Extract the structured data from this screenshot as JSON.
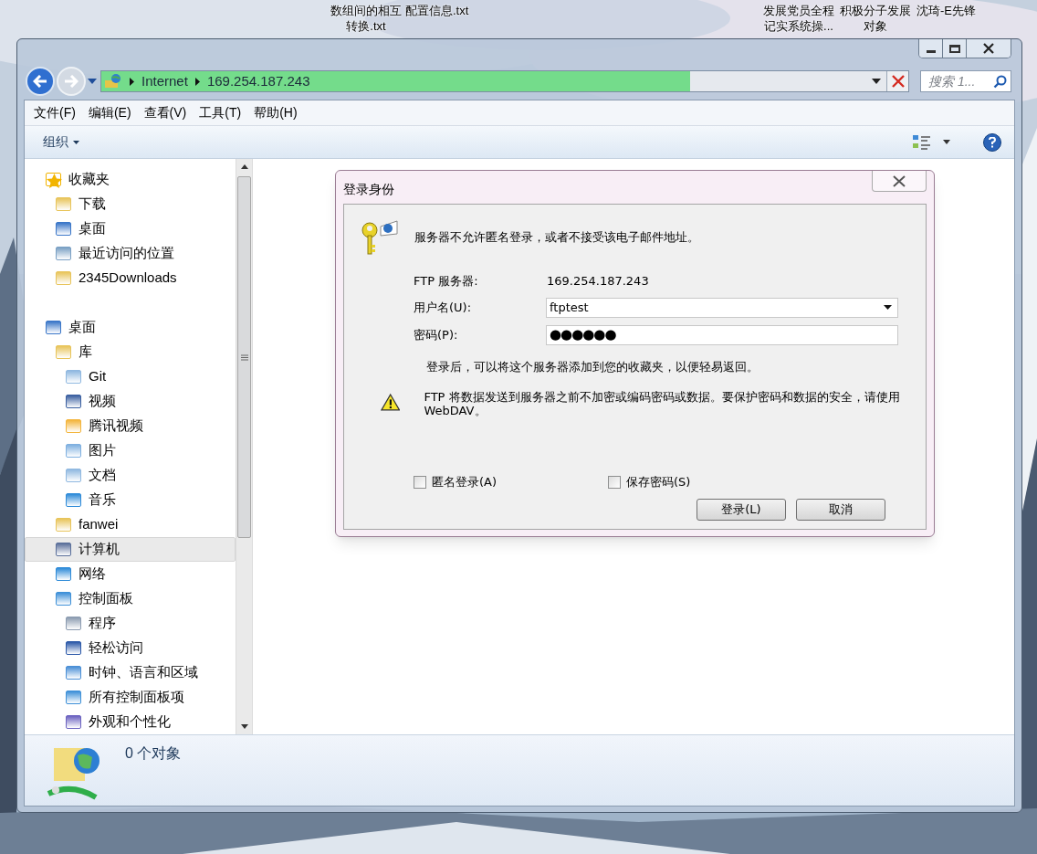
{
  "desktop_icons": [
    {
      "lines": [
        "数组间的相互",
        "转换.txt"
      ]
    },
    {
      "lines": [
        "配置信息.txt"
      ]
    },
    {
      "lines": [
        "发展党员全程",
        "记实系统操..."
      ]
    },
    {
      "lines": [
        "积极分子发展",
        "对象"
      ]
    },
    {
      "lines": [
        "沈琦-E先锋"
      ]
    }
  ],
  "address_bar": {
    "path": [
      "Internet",
      "169.254.187.243"
    ],
    "level": 0.73
  },
  "search": {
    "placeholder": "搜索 1..."
  },
  "menu": [
    "文件(F)",
    "编辑(E)",
    "查看(V)",
    "工具(T)",
    "帮助(H)"
  ],
  "toolbar": {
    "organize": "组织"
  },
  "sidebar": {
    "groups": [
      [
        {
          "label": "收藏夹",
          "selected": false,
          "children": [
            {
              "label": "下载",
              "selected": false
            },
            {
              "label": "桌面",
              "selected": false
            },
            {
              "label": "最近访问的位置",
              "selected": false
            },
            {
              "label": "2345Downloads",
              "selected": false
            }
          ]
        }
      ],
      [
        {
          "label": "桌面",
          "selected": false,
          "children": [
            {
              "label": "库",
              "selected": false,
              "children": [
                {
                  "label": "Git",
                  "selected": false
                },
                {
                  "label": "视频",
                  "selected": false
                },
                {
                  "label": "腾讯视频",
                  "selected": false
                },
                {
                  "label": "图片",
                  "selected": false
                },
                {
                  "label": "文档",
                  "selected": false
                },
                {
                  "label": "音乐",
                  "selected": false
                }
              ]
            },
            {
              "label": "fanwei",
              "selected": false
            },
            {
              "label": "计算机",
              "selected": true
            },
            {
              "label": "网络",
              "selected": false
            },
            {
              "label": "控制面板",
              "selected": false,
              "children": [
                {
                  "label": "程序",
                  "selected": false
                },
                {
                  "label": "轻松访问",
                  "selected": false
                },
                {
                  "label": "时钟、语言和区域",
                  "selected": false
                },
                {
                  "label": "所有控制面板项",
                  "selected": false
                },
                {
                  "label": "外观和个性化",
                  "selected": false
                }
              ]
            }
          ]
        }
      ]
    ]
  },
  "details": {
    "count": "0 个对象"
  },
  "dialog": {
    "title": "登录身份",
    "message": "服务器不允许匿名登录，或者不接受该电子邮件地址。",
    "server_label": "FTP 服务器:",
    "server": "169.254.187.243",
    "user_label": "用户名(U):",
    "user_value": "ftptest",
    "password_label": "密码(P):",
    "password_value": "●●●●●●",
    "note": "登录后，可以将这个服务器添加到您的收藏夹，以便轻易返回。",
    "warning": "FTP 将数据发送到服务器之前不加密或编码密码或数据。要保护密码和数据的安全，请使用 WebDAV。",
    "checkboxes": [
      {
        "label": "匿名登录(A)",
        "checked": false
      },
      {
        "label": "保存密码(S)",
        "checked": false
      }
    ],
    "buttons": [
      "登录(L)",
      "取消"
    ]
  }
}
